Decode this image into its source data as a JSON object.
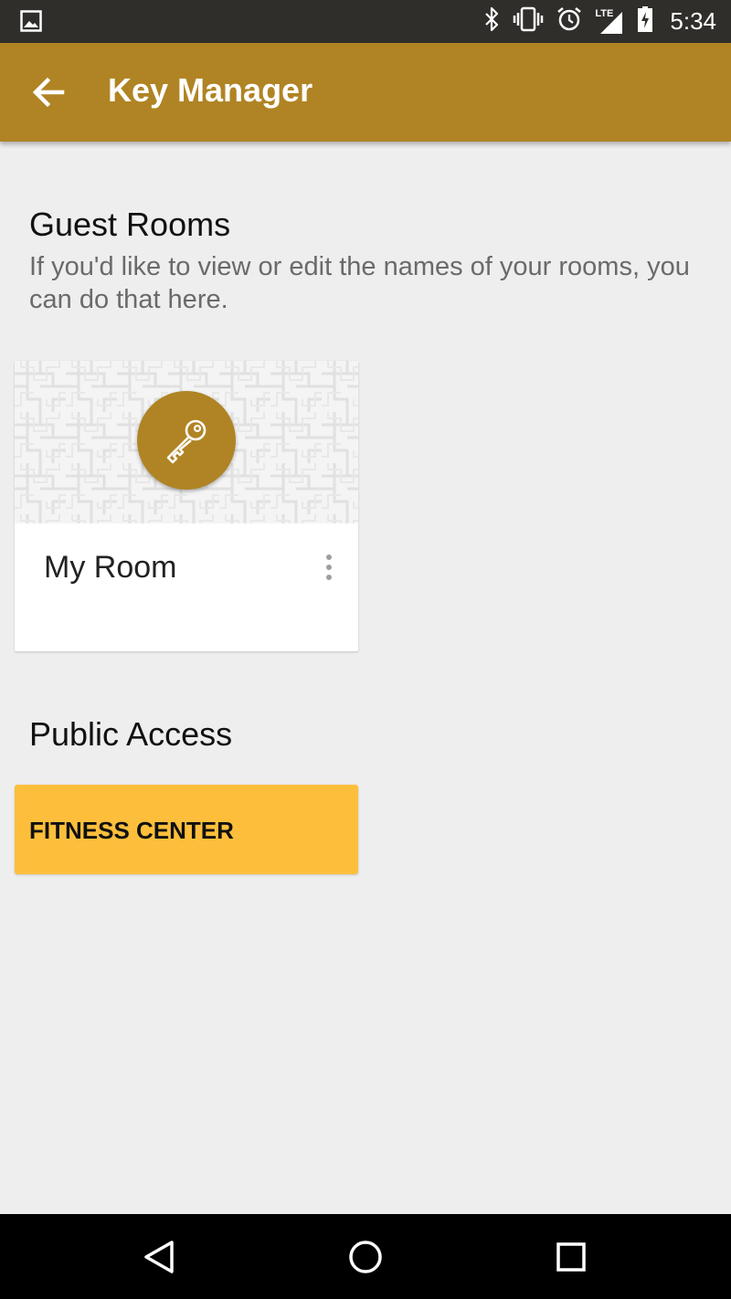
{
  "status_bar": {
    "time": "5:34",
    "network_label": "LTE",
    "icons": [
      "image-notification-icon",
      "bluetooth-icon",
      "vibrate-icon",
      "alarm-icon",
      "signal-icon",
      "battery-icon"
    ]
  },
  "app_bar": {
    "title": "Key Manager",
    "back_icon": "arrow-back-icon",
    "color": "#b08424"
  },
  "guest_rooms": {
    "title": "Guest Rooms",
    "description": "If you'd like to view or edit the names of your rooms, you can do that here.",
    "rooms": [
      {
        "name": "My Room",
        "icon": "key-icon",
        "menu_icon": "more-vert-icon"
      }
    ]
  },
  "public_access": {
    "title": "Public Access",
    "items": [
      {
        "label": "FITNESS CENTER",
        "color": "#fdbf3b"
      }
    ]
  },
  "nav_bar": {
    "buttons": [
      "back-triangle-icon",
      "home-circle-icon",
      "recents-square-icon"
    ]
  }
}
